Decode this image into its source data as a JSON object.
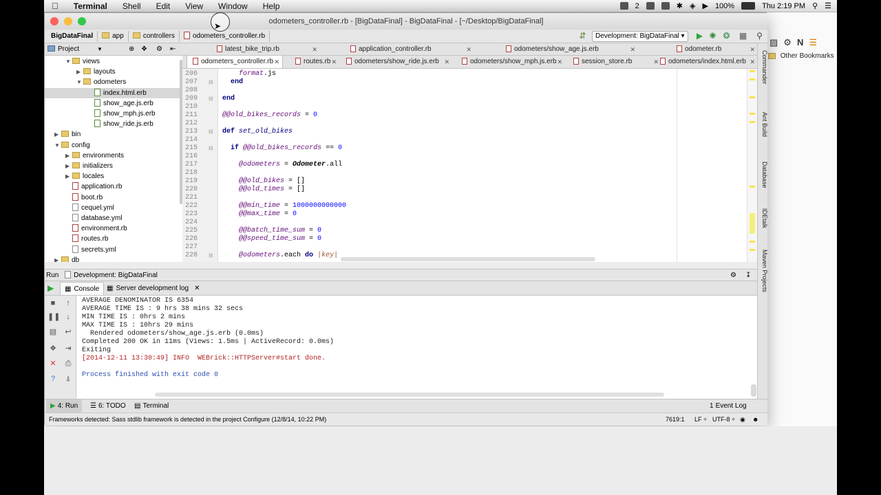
{
  "menubar": {
    "app": "Terminal",
    "items": [
      "Shell",
      "Edit",
      "View",
      "Window",
      "Help"
    ],
    "battery": "100%",
    "clock": "Thu 2:19 PM",
    "notif_count": "2"
  },
  "browser": {
    "other_bookmarks": "Other Bookmarks"
  },
  "window": {
    "title": "odometers_controller.rb - [BigDataFinal] - BigDataFinal - [~/Desktop/BigDataFinal]"
  },
  "breadcrumb": [
    "BigDataFinal",
    "app",
    "controllers",
    "odometers_controller.rb"
  ],
  "run_config": "Development: BigDataFinal",
  "project": {
    "header": "Project",
    "tree": [
      {
        "label": "views",
        "kind": "folder",
        "depth": 1,
        "open": true
      },
      {
        "label": "layouts",
        "kind": "folder",
        "depth": 2,
        "open": false
      },
      {
        "label": "odometers",
        "kind": "folder",
        "depth": 2,
        "open": true
      },
      {
        "label": "index.html.erb",
        "kind": "erb",
        "depth": 3,
        "selected": true
      },
      {
        "label": "show_age.js.erb",
        "kind": "erb",
        "depth": 3
      },
      {
        "label": "show_mph.js.erb",
        "kind": "erb",
        "depth": 3
      },
      {
        "label": "show_ride.js.erb",
        "kind": "erb",
        "depth": 3
      },
      {
        "label": "bin",
        "kind": "folder",
        "depth": 0,
        "open": false
      },
      {
        "label": "config",
        "kind": "folder",
        "depth": 0,
        "open": true
      },
      {
        "label": "environments",
        "kind": "folder",
        "depth": 1,
        "open": false
      },
      {
        "label": "initializers",
        "kind": "folder",
        "depth": 1,
        "open": false
      },
      {
        "label": "locales",
        "kind": "folder",
        "depth": 1,
        "open": false
      },
      {
        "label": "application.rb",
        "kind": "rb",
        "depth": 1
      },
      {
        "label": "boot.rb",
        "kind": "rb",
        "depth": 1
      },
      {
        "label": "cequel.yml",
        "kind": "yml",
        "depth": 1
      },
      {
        "label": "database.yml",
        "kind": "yml",
        "depth": 1
      },
      {
        "label": "environment.rb",
        "kind": "rb",
        "depth": 1
      },
      {
        "label": "routes.rb",
        "kind": "rb",
        "depth": 1
      },
      {
        "label": "secrets.yml",
        "kind": "yml",
        "depth": 1
      },
      {
        "label": "db",
        "kind": "folder",
        "depth": 0,
        "open": false
      }
    ]
  },
  "tabs_row1": [
    "latest_bike_trip.rb",
    "application_controller.rb",
    "odometers/show_age.js.erb",
    "odometer.rb"
  ],
  "tabs_row2": [
    "odometers_controller.rb",
    "routes.rb",
    "odometers/show_ride.js.erb",
    "odometers/show_mph.js.erb",
    "session_store.rb",
    "odometers/index.html.erb"
  ],
  "editor": {
    "lines": [
      {
        "n": "206",
        "text": "    format.js"
      },
      {
        "n": "207",
        "text": "  end"
      },
      {
        "n": "208",
        "text": ""
      },
      {
        "n": "209",
        "text": "end"
      },
      {
        "n": "210",
        "text": ""
      },
      {
        "n": "211",
        "text": "@@old_bikes_records = 0"
      },
      {
        "n": "212",
        "text": ""
      },
      {
        "n": "213",
        "text": "def set_old_bikes"
      },
      {
        "n": "214",
        "text": ""
      },
      {
        "n": "215",
        "text": "  if @@old_bikes_records == 0"
      },
      {
        "n": "216",
        "text": ""
      },
      {
        "n": "217",
        "text": "    @odometers = Odometer.all"
      },
      {
        "n": "218",
        "text": ""
      },
      {
        "n": "219",
        "text": "    @@old_bikes = []"
      },
      {
        "n": "220",
        "text": "    @@old_times = []"
      },
      {
        "n": "221",
        "text": ""
      },
      {
        "n": "222",
        "text": "    @@min_time = 1000000000000"
      },
      {
        "n": "223",
        "text": "    @@max_time = 0"
      },
      {
        "n": "224",
        "text": ""
      },
      {
        "n": "225",
        "text": "    @@batch_time_sum = 0"
      },
      {
        "n": "226",
        "text": "    @@speed_time_sum = 0"
      },
      {
        "n": "227",
        "text": ""
      },
      {
        "n": "228",
        "text": "    @odometers.each do |key|"
      }
    ]
  },
  "right_tools": [
    "Commander",
    "Ant Build",
    "Database",
    "IDEtalk",
    "Maven Projects"
  ],
  "run": {
    "header_label": "Run",
    "header_config": "Development: BigDataFinal",
    "tab_console": "Console",
    "tab_server_log": "Server development log",
    "output": [
      {
        "text": "AVERAGE DENOMINATOR IS 6354",
        "style": "normal"
      },
      {
        "text": "AVERAGE TIME IS : 9 hrs 38 mins 32 secs",
        "style": "normal"
      },
      {
        "text": "MIN TIME IS : 0hrs 2 mins",
        "style": "normal"
      },
      {
        "text": "MAX TIME IS : 10hrs 29 mins",
        "style": "normal"
      },
      {
        "text": "  Rendered odometers/show_age.js.erb (0.0ms)",
        "style": "normal"
      },
      {
        "text": "Completed 200 OK in 11ms (Views: 1.5ms | ActiveRecord: 0.0ms)",
        "style": "normal"
      },
      {
        "text": "Exiting",
        "style": "normal"
      },
      {
        "text": "[2014-12-11 13:30:49] INFO  WEBrick::HTTPServer#start done.",
        "style": "red"
      },
      {
        "text": "",
        "style": "normal"
      },
      {
        "text": "Process finished with exit code 0",
        "style": "blue"
      }
    ]
  },
  "bottom_tabs": {
    "run": "4: Run",
    "todo": "6: TODO",
    "terminal": "Terminal",
    "event_log": "Event Log",
    "event_count": "1"
  },
  "status": {
    "message": "Frameworks detected: Sass stdlib framework is detected in the project Configure (12/8/14, 10:22 PM)",
    "position": "7619:1",
    "line_sep": "LF",
    "encoding": "UTF-8"
  }
}
